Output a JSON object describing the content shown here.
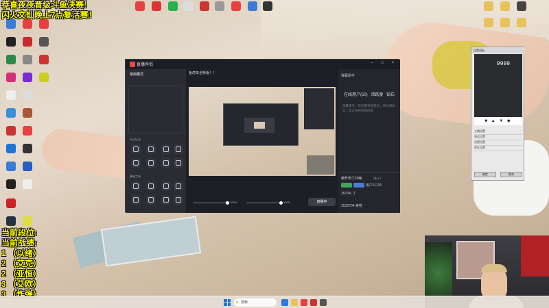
{
  "overlay": {
    "announcement": [
      "恭喜夜夜晋级斗鱼决赛！",
      "闪火文灿晚上7点复活赛！"
    ],
    "rank_title": "当前段位:",
    "record_title": "当前战绩:",
    "records": [
      "1 （以绪）",
      "2 （艾克）",
      "2 （亚恒）",
      "3 （艾欧）",
      "3 （炸弹）"
    ]
  },
  "streaming_app": {
    "title": "直播伴侣",
    "sidebar_header": "常用模式",
    "sections": [
      "玩法玩法",
      "基础工具"
    ],
    "room_title": "鱼虎年全新版！！",
    "live_button": "直播中",
    "volume": [
      "100%",
      "100%"
    ],
    "right_panel": {
      "title": "弹幕助手",
      "tabs": [
        "在线用户(50)",
        "活跃度",
        "钻石"
      ],
      "notice": "温馨提示：欢迎来到直播间，请文明发言，禁止发布违规内容",
      "upgrade": "荣升到了20级",
      "count": "1条/1人",
      "user": "用户11135",
      "lines": [
        "35704: 了",
        "3535704 来啦"
      ]
    }
  },
  "dialog": {
    "title": "设置面板",
    "number": "9999",
    "rows": [
      "主播设置",
      "测试设置",
      "设置设置",
      "保存设置"
    ],
    "buttons": [
      "确定",
      "取消"
    ]
  },
  "taskbar": {
    "search_placeholder": "搜索"
  }
}
